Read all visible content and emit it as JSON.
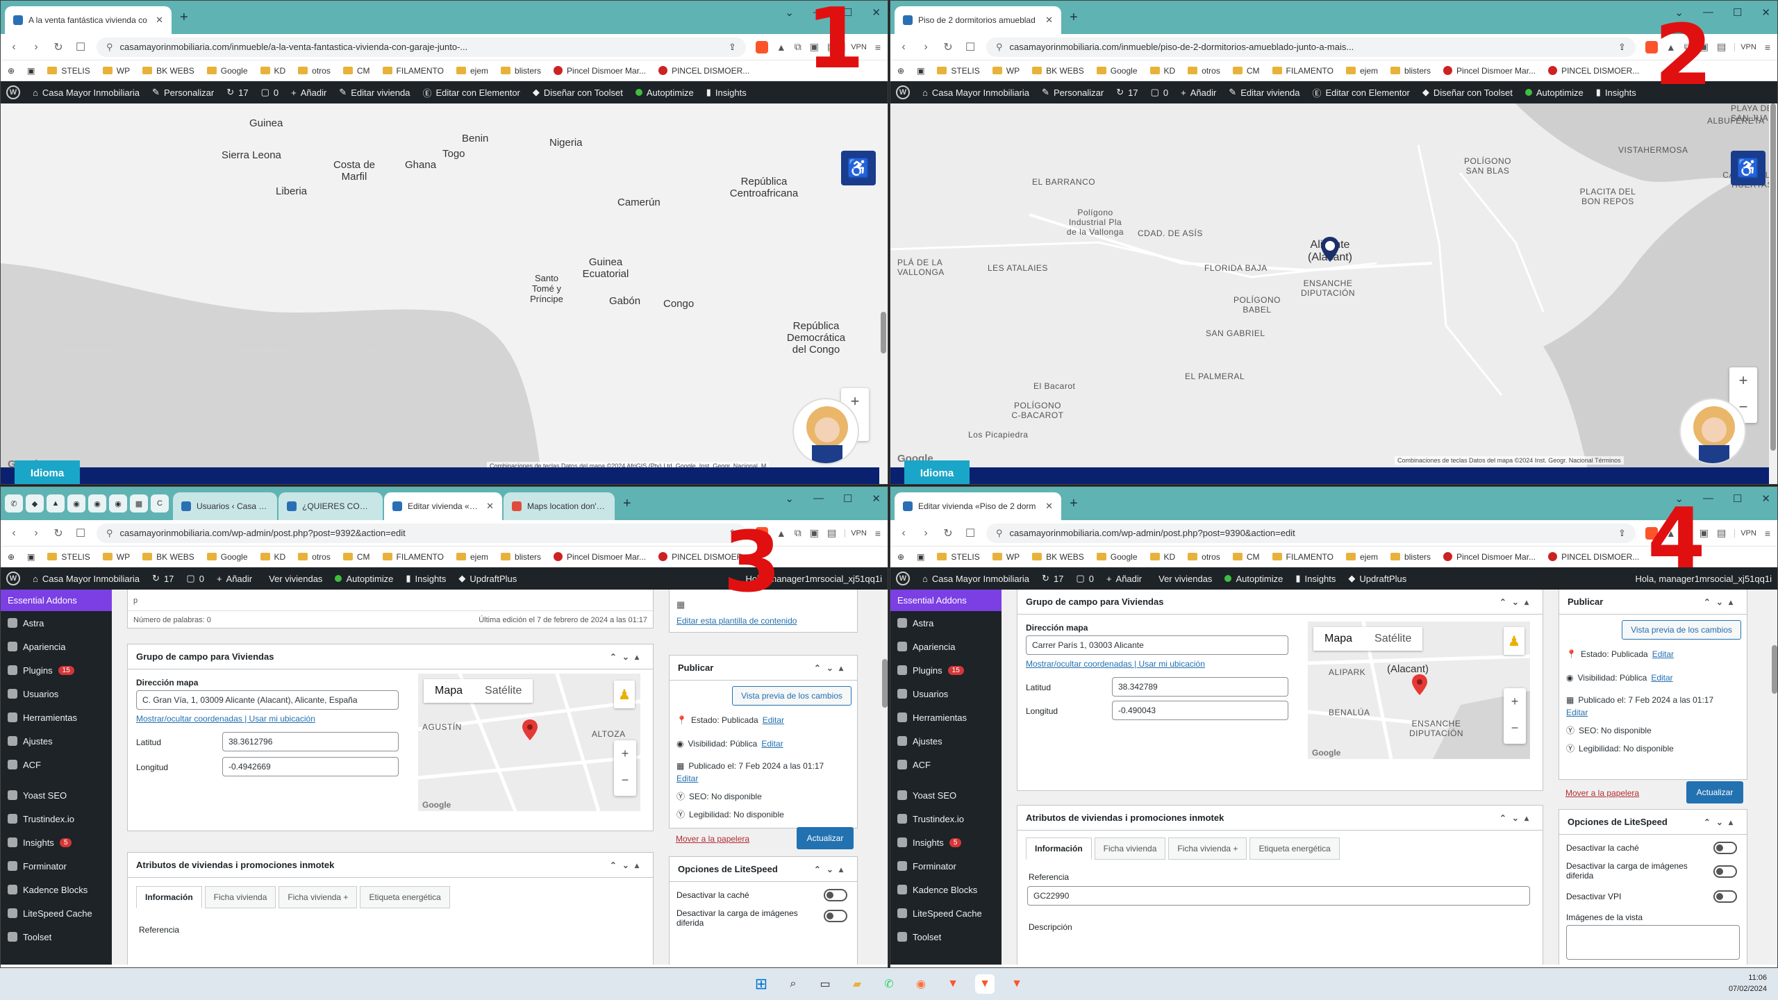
{
  "w1": {
    "tab_title": "A la venta fantástica vivienda co",
    "url": "casamayorinmobiliaria.com/inmueble/a-la-venta-fantastica-vivienda-con-garaje-junto-...",
    "idioma": "Idioma",
    "map_labels": [
      "Guinea",
      "Benin",
      "Nigeria",
      "Sierra Leona",
      "Costa de Marfil",
      "Togo",
      "Ghana",
      "República Centroafricana",
      "Liberia",
      "Camerún",
      "Guinea Ecuatorial",
      "Santo Tomé y Príncipe",
      "Gabón",
      "Congo",
      "República Democrática del Congo"
    ],
    "credit": "Combinaciones de teclas   Datos del mapa ©2024 AfriGIS (Pty) Ltd, Google, Inst. Geogr. Nacional, M"
  },
  "w2": {
    "tab_title": "Piso de 2 dormitorios amueblad",
    "url": "casamayorinmobiliaria.com/inmueble/piso-de-2-dormitorios-amueblado-junto-a-mais...",
    "idioma": "Idioma",
    "map_labels": [
      "ALBUFERETA",
      "PLAYA DE SAN JUAN",
      "VISTAHERMOSA",
      "POLÍGONO SAN BLAS",
      "CABO DE LAS HUERTAS",
      "EL BARRANCO",
      "PLACITA DEL BON REPOS",
      "Polígono Industrial Pla de la Vallonga",
      "CDAD. DE ASÍS",
      "Alicante (Alacant)",
      "PLÁ DE LA VALLONGA",
      "LES ATALAIES",
      "FLORIDA BAJA",
      "ENSANCHE DIPUTACIÓN",
      "POLÍGONO BABEL",
      "SAN GABRIEL",
      "EL PALMERAL",
      "El Bacarot",
      "POLÍGONO C-BACAROT",
      "Los Picapiedra"
    ],
    "credit": "Combinaciones de teclas   Datos del mapa ©2024 Inst. Geogr. Nacional   Términos"
  },
  "bookmarks": [
    "STELIS",
    "WP",
    "BK WEBS",
    "Google",
    "KD",
    "otros",
    "CM",
    "FILAMENTO",
    "ejem",
    "blisters",
    "Pincel Dismoer Mar...",
    "PINCEL DISMOER..."
  ],
  "wpbar_front": [
    "Casa Mayor Inmobiliaria",
    "Personalizar",
    "17",
    "0",
    "Añadir",
    "Editar vivienda",
    "Editar con Elementor",
    "Diseñar con Toolset",
    "Autoptimize",
    "Insights"
  ],
  "wpbar_admin": [
    "Casa Mayor Inmobiliaria",
    "17",
    "0",
    "Añadir",
    "Ver viviendas",
    "Autoptimize",
    "Insights",
    "UpdraftPlus"
  ],
  "w3": {
    "tabs": [
      "Usuarios ‹ Casa Mayor ›",
      "¿QUIERES COMPRAR / A",
      "Editar vivienda «A la",
      "Maps location don't wor"
    ],
    "url": "casamayorinmobiliaria.com/wp-admin/post.php?post=9392&action=edit",
    "howdy": "Hola, manager1mrsocial_xj51qq1i",
    "word_count": "Número de palabras: 0",
    "last_edit": "Última edición el 7 de febrero de 2024 a las 01:17",
    "p_tag": "p",
    "group_title": "Grupo de campo para Viviendas",
    "dir_label": "Dirección mapa",
    "dir_value": "C. Gran Vía, 1, 03009 Alicante (Alacant), Alicante, España",
    "links": "Mostrar/ocultar coordenadas | Usar mi ubicación",
    "lat_label": "Latitud",
    "lat_value": "38.3612796",
    "lng_label": "Longitud",
    "lng_value": "-0.4942669",
    "map_btn": "Mapa",
    "sat_btn": "Satélite",
    "minimap_labels": [
      "AGUSTÍN",
      "ALTOZA"
    ],
    "template_link": "Editar esta plantilla de contenido",
    "pub_title": "Publicar",
    "preview": "Vista previa de los cambios",
    "estado": "Estado: Publicada",
    "visib": "Visibilidad: Pública",
    "published": "Publicado el: 7 Feb 2024 a las 01:17",
    "seo": "SEO: No disponible",
    "leg": "Legibilidad: No disponible",
    "edit": "Editar",
    "trash": "Mover a la papelera",
    "update": "Actualizar",
    "attr_title": "Atributos de viviendas i promociones inmotek",
    "attr_tabs": [
      "Información",
      "Ficha vivienda",
      "Ficha vivienda +",
      "Etiqueta energética"
    ],
    "ref_label": "Referencia",
    "ls_title": "Opciones de LiteSpeed",
    "ls_opts": [
      "Desactivar la caché",
      "Desactivar la carga de imágenes diferida"
    ]
  },
  "w4": {
    "tab_title": "Editar vivienda «Piso de 2 dorm",
    "url": "casamayorinmobiliaria.com/wp-admin/post.php?post=9390&action=edit",
    "howdy": "Hola, manager1mrsocial_xj51qq1i",
    "group_title": "Grupo de campo para Viviendas",
    "dir_label": "Dirección mapa",
    "dir_value": "Carrer París 1, 03003 Alicante",
    "links": "Mostrar/ocultar coordenadas | Usar mi ubicación",
    "lat_label": "Latitud",
    "lat_value": "38.342789",
    "lng_label": "Longitud",
    "lng_value": "-0.490043",
    "map_btn": "Mapa",
    "sat_btn": "Satélite",
    "minimap_labels": [
      "ALIPARK",
      "(Alacant)",
      "BENALÚA",
      "ENSANCHE DIPUTACIÓN"
    ],
    "pub_title": "Publicar",
    "preview": "Vista previa de los cambios",
    "estado": "Estado: Publicada",
    "visib": "Visibilidad: Pública",
    "published": "Publicado el: 7 Feb 2024 a las 01:17",
    "seo": "SEO: No disponible",
    "leg": "Legibilidad: No disponible",
    "edit": "Editar",
    "trash": "Mover a la papelera",
    "update": "Actualizar",
    "attr_title": "Atributos de viviendas i promociones inmotek",
    "attr_tabs": [
      "Información",
      "Ficha vivienda",
      "Ficha vivienda +",
      "Etiqueta energética"
    ],
    "ref_label": "Referencia",
    "ref_value": "GC22990",
    "desc_label": "Descripción",
    "ls_title": "Opciones de LiteSpeed",
    "ls_opts": [
      "Desactivar la caché",
      "Desactivar la carga de imágenes diferida",
      "Desactivar VPI"
    ],
    "ls_img": "Imágenes de la vista"
  },
  "sidebar": [
    {
      "label": "Astra"
    },
    {
      "label": "Apariencia"
    },
    {
      "label": "Plugins",
      "badge": "15"
    },
    {
      "label": "Usuarios"
    },
    {
      "label": "Herramientas"
    },
    {
      "label": "Ajustes"
    },
    {
      "label": "ACF"
    },
    {
      "label": "Yoast SEO"
    },
    {
      "label": "Trustindex.io"
    },
    {
      "label": "Insights",
      "badge": "5"
    },
    {
      "label": "Forminator"
    },
    {
      "label": "Kadence Blocks"
    },
    {
      "label": "LiteSpeed Cache"
    },
    {
      "label": "Toolset"
    }
  ],
  "sidebar_top": "Essential Addons",
  "handnums": [
    "1",
    "2",
    "3",
    "4"
  ],
  "clock": {
    "time": "11:06",
    "date": "07/02/2024"
  },
  "google": "Google",
  "vpn": "VPN"
}
